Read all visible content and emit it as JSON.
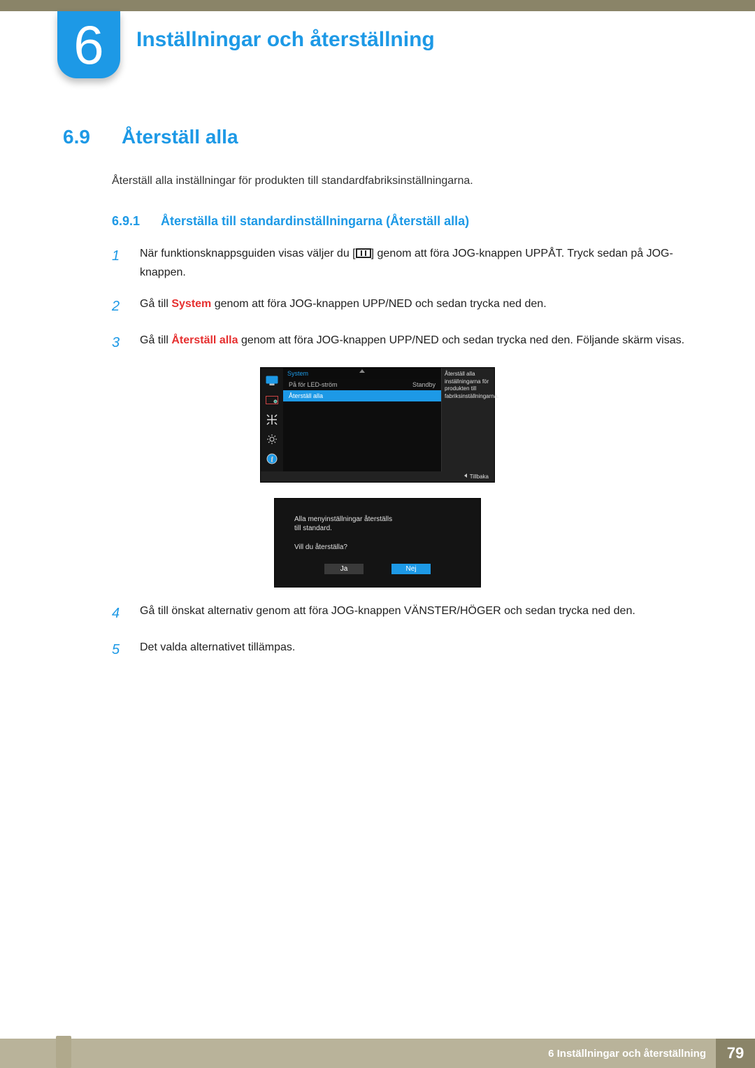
{
  "chapter": {
    "number": "6",
    "title": "Inställningar och återställning"
  },
  "section": {
    "number": "6.9",
    "title": "Återställ alla"
  },
  "intro": "Återställ alla inställningar för produkten till standardfabriksinställningarna.",
  "subsection": {
    "number": "6.9.1",
    "title": "Återställa till standardinställningarna (Återställ alla)"
  },
  "steps": {
    "s1a": "När funktionsknappsguiden visas väljer du [",
    "s1b": "] genom att föra JOG-knappen UPPÅT. Tryck sedan på JOG-knappen.",
    "s2a": "Gå till ",
    "s2red": "System",
    "s2b": " genom att föra JOG-knappen UPP/NED och sedan trycka ned den.",
    "s3a": "Gå till ",
    "s3red": "Återställ alla",
    "s3b": " genom att föra JOG-knappen UPP/NED och sedan trycka ned den. Följande skärm visas.",
    "s4": "Gå till önskat alternativ genom att föra JOG-knappen VÄNSTER/HÖGER och sedan trycka ned den.",
    "s5": "Det valda alternativet tillämpas."
  },
  "numbers": {
    "n1": "1",
    "n2": "2",
    "n3": "3",
    "n4": "4",
    "n5": "5"
  },
  "osd": {
    "header": "System",
    "row1_label": "På för LED-ström",
    "row1_value": "Standby",
    "row2_label": "Återställ alla",
    "side_text": "Återställ alla inställningarna för produkten till fabriksinställningarna.",
    "footer": "Tillbaka"
  },
  "dialog": {
    "line1": "Alla menyinställningar återställs",
    "line2": "till standard.",
    "line3": "Vill du återställa?",
    "ja": "Ja",
    "nej": "Nej"
  },
  "footer": {
    "label": "6 Inställningar och återställning",
    "page": "79"
  }
}
